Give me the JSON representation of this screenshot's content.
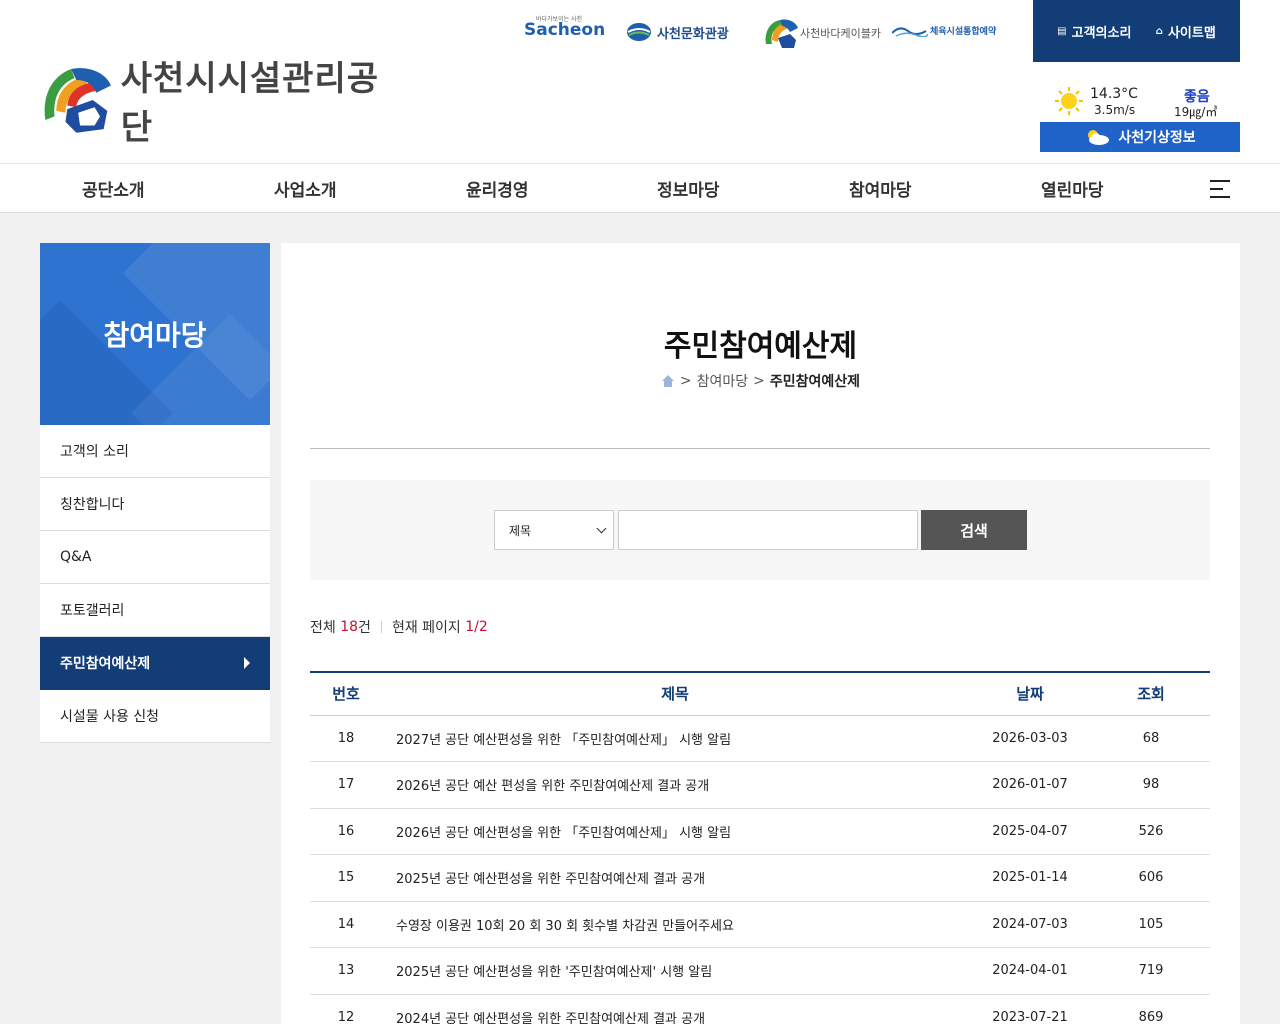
{
  "header": {
    "logo_text": "사천시시설관리공단",
    "family_links": {
      "sacheon": "Sacheon",
      "sacheon_small": "바다가보이는 사천",
      "culture": "사천문화관광",
      "cable": "사천바다케이블카",
      "sports": "체육시설통합예약"
    },
    "util": {
      "voice": "고객의소리",
      "sitemap": "사이트맵"
    },
    "weather": {
      "temp": "14.3°C",
      "wind": "3.5m/s",
      "air_grade": "좋음",
      "air_value": "19㎍/㎥",
      "button": "사천기상정보"
    }
  },
  "gnb": [
    "공단소개",
    "사업소개",
    "윤리경영",
    "정보마당",
    "참여마당",
    "열린마당"
  ],
  "lnb": {
    "title": "참여마당",
    "items": [
      "고객의 소리",
      "칭찬합니다",
      "Q&A",
      "포토갤러리",
      "주민참여예산제",
      "시설물 사용 신청"
    ],
    "active_index": 4
  },
  "page": {
    "title": "주민참여예산제",
    "breadcrumb": {
      "sep": ">",
      "parent": "참여마당",
      "current": "주민참여예산제"
    }
  },
  "search": {
    "select_value": "제목",
    "input_value": "",
    "button": "검색"
  },
  "count": {
    "total_label": "전체",
    "total_num": "18",
    "total_unit": "건",
    "page_label": "현재 페이지",
    "page_value": "1/2"
  },
  "table": {
    "headers": [
      "번호",
      "제목",
      "날짜",
      "조회"
    ],
    "rows": [
      {
        "no": "18",
        "title": "2027년 공단 예산편성을 위한 「주민참여예산제」 시행 알림",
        "date": "2026-03-03",
        "views": "68"
      },
      {
        "no": "17",
        "title": "2026년 공단 예산 편성을 위한 주민참여예산제 결과 공개",
        "date": "2026-01-07",
        "views": "98"
      },
      {
        "no": "16",
        "title": "2026년 공단 예산편성을 위한 「주민참여예산제」 시행 알림",
        "date": "2025-04-07",
        "views": "526"
      },
      {
        "no": "15",
        "title": "2025년 공단 예산편성을 위한 주민참여예산제 결과 공개",
        "date": "2025-01-14",
        "views": "606"
      },
      {
        "no": "14",
        "title": "수영장 이용권 10회 20 회 30 회 횟수별 차감권 만들어주세요",
        "date": "2024-07-03",
        "views": "105"
      },
      {
        "no": "13",
        "title": "2025년 공단 예산편성을 위한 '주민참여예산제' 시행 알림",
        "date": "2024-04-01",
        "views": "719"
      },
      {
        "no": "12",
        "title": "2024년 공단 예산편성을 위한 주민참여예산제 결과 공개",
        "date": "2023-07-21",
        "views": "869"
      }
    ]
  },
  "colors": {
    "navy": "#133d77",
    "blue": "#2f73d0",
    "weather_blue": "#1f63c9",
    "count_red": "#c8102e"
  }
}
